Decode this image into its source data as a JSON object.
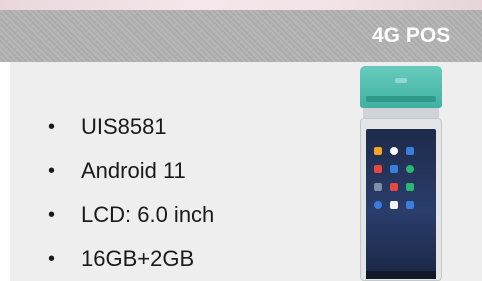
{
  "slide": {
    "title": "4G POS",
    "specs": [
      "UIS8581",
      "Android 11",
      "LCD: 6.0 inch",
      "16GB+2GB"
    ],
    "bullet": "•"
  },
  "colors": {
    "header_band": "#b0b0b0",
    "panel": "#eeeeee",
    "printer_accent": "#4fbfb0"
  }
}
